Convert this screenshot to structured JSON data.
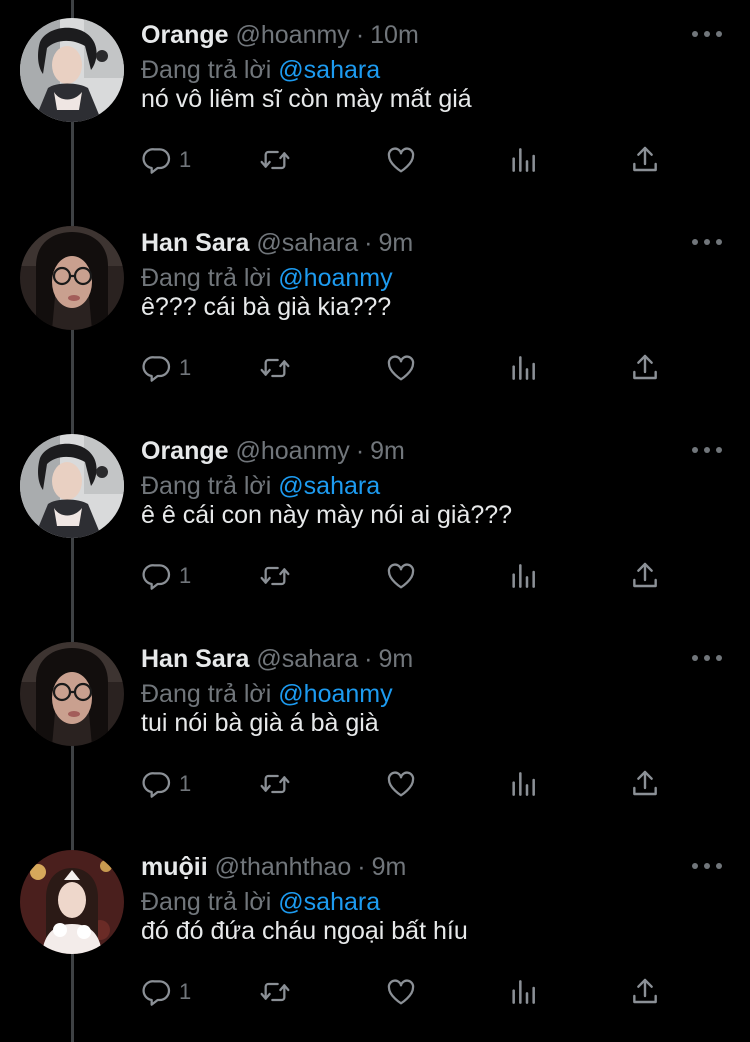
{
  "reply_prefix": "Đang trả lời",
  "colors": {
    "background": "#000000",
    "text": "#e7e9ea",
    "muted": "#71767b",
    "mention": "#1d9bf0",
    "thread_line": "#3e4144"
  },
  "action_icons": [
    "reply-icon",
    "retweet-icon",
    "like-icon",
    "analytics-icon",
    "share-icon"
  ],
  "tweets": [
    {
      "name": "Orange",
      "handle": "@hoanmy",
      "dot": "·",
      "time": "10m",
      "mention": "@sahara",
      "text": "nó vô liêm sĩ còn mày mất giá",
      "reply_count": "1",
      "avatar": "orange"
    },
    {
      "name": "Han Sara",
      "handle": "@sahara",
      "dot": "·",
      "time": "9m",
      "mention": "@hoanmy",
      "text": "ê??? cái bà già kia???",
      "reply_count": "1",
      "avatar": "sara"
    },
    {
      "name": "Orange",
      "handle": "@hoanmy",
      "dot": "·",
      "time": "9m",
      "mention": "@sahara",
      "text": "ê ê cái con này mày nói ai già???",
      "reply_count": "1",
      "avatar": "orange"
    },
    {
      "name": "Han Sara",
      "handle": "@sahara",
      "dot": "·",
      "time": "9m",
      "mention": "@hoanmy",
      "text": "tui nói bà già á bà già",
      "reply_count": "1",
      "avatar": "sara"
    },
    {
      "name": "muộii",
      "handle": "@thanhthao",
      "dot": "·",
      "time": "9m",
      "mention": "@sahara",
      "text": "đó đó đứa cháu ngoại bất híu",
      "reply_count": "1",
      "avatar": "muoi"
    }
  ]
}
